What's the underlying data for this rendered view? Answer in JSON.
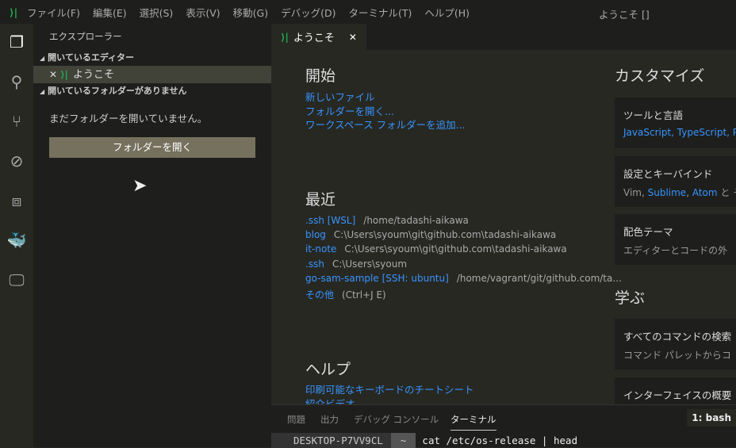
{
  "titlebar": {
    "menu": [
      "ファイル(F)",
      "編集(E)",
      "選択(S)",
      "表示(V)",
      "移動(G)",
      "デバッグ(D)",
      "ターミナル(T)",
      "ヘルプ(H)"
    ],
    "window_title": "ようこそ []"
  },
  "sidebar": {
    "title": "エクスプローラー",
    "open_editors": "開いているエディター",
    "open_editor_item": "ようこそ",
    "no_folder_section": "開いているフォルダーがありません",
    "empty_message": "まだフォルダーを開いていません。",
    "open_folder_button": "フォルダーを開く"
  },
  "tab": {
    "label": "ようこそ"
  },
  "welcome": {
    "start": {
      "title": "開始",
      "links": [
        "新しいファイル",
        "フォルダーを開く...",
        "ワークスペース フォルダーを追加..."
      ]
    },
    "recent": {
      "title": "最近",
      "items": [
        {
          "name": ".ssh [WSL]",
          "path": "/home/tadashi-aikawa"
        },
        {
          "name": "blog",
          "path": "C:\\Users\\syoum\\git\\github.com\\tadashi-aikawa"
        },
        {
          "name": "it-note",
          "path": "C:\\Users\\syoum\\git\\github.com\\tadashi-aikawa"
        },
        {
          "name": ".ssh",
          "path": "C:\\Users\\syoum"
        },
        {
          "name": "go-sam-sample [SSH: ubuntu]",
          "path": "/home/vagrant/git/github.com/ta..."
        }
      ],
      "more": "その他",
      "more_shortcut": "(Ctrl+J E)"
    },
    "help": {
      "title": "ヘルプ",
      "links": [
        "印刷可能なキーボードのチートシート",
        "紹介ビデオ"
      ]
    },
    "customize": {
      "title": "カスタマイズ",
      "cards": [
        {
          "title": "ツールと言語",
          "desc": "JavaScript, TypeScript, Py"
        },
        {
          "title": "設定とキーバインド",
          "desc_prefix": "Vim, ",
          "desc_links": [
            "Sublime",
            ", ",
            "Atom"
          ],
          "desc_suffix": " と そ"
        },
        {
          "title": "配色テーマ",
          "desc": "エディターとコードの外"
        }
      ]
    },
    "learn": {
      "title": "学ぶ",
      "cards": [
        {
          "title": "すべてのコマンドの検索",
          "desc": "コマンド パレットからコ"
        },
        {
          "title": "インターフェイスの概要",
          "desc": ""
        }
      ]
    }
  },
  "panel": {
    "tabs": [
      "問題",
      "出力",
      "デバッグ コンソール",
      "ターミナル"
    ],
    "active_tab": "ターミナル",
    "terminal_select": "1: bash",
    "host": "DESKTOP-P7VV9CL",
    "dir": "~",
    "command": "cat /etc/os-release | head"
  },
  "colors": {
    "accent_link": "#3794ff",
    "logo": "#23a94e",
    "button": "#75715e"
  }
}
